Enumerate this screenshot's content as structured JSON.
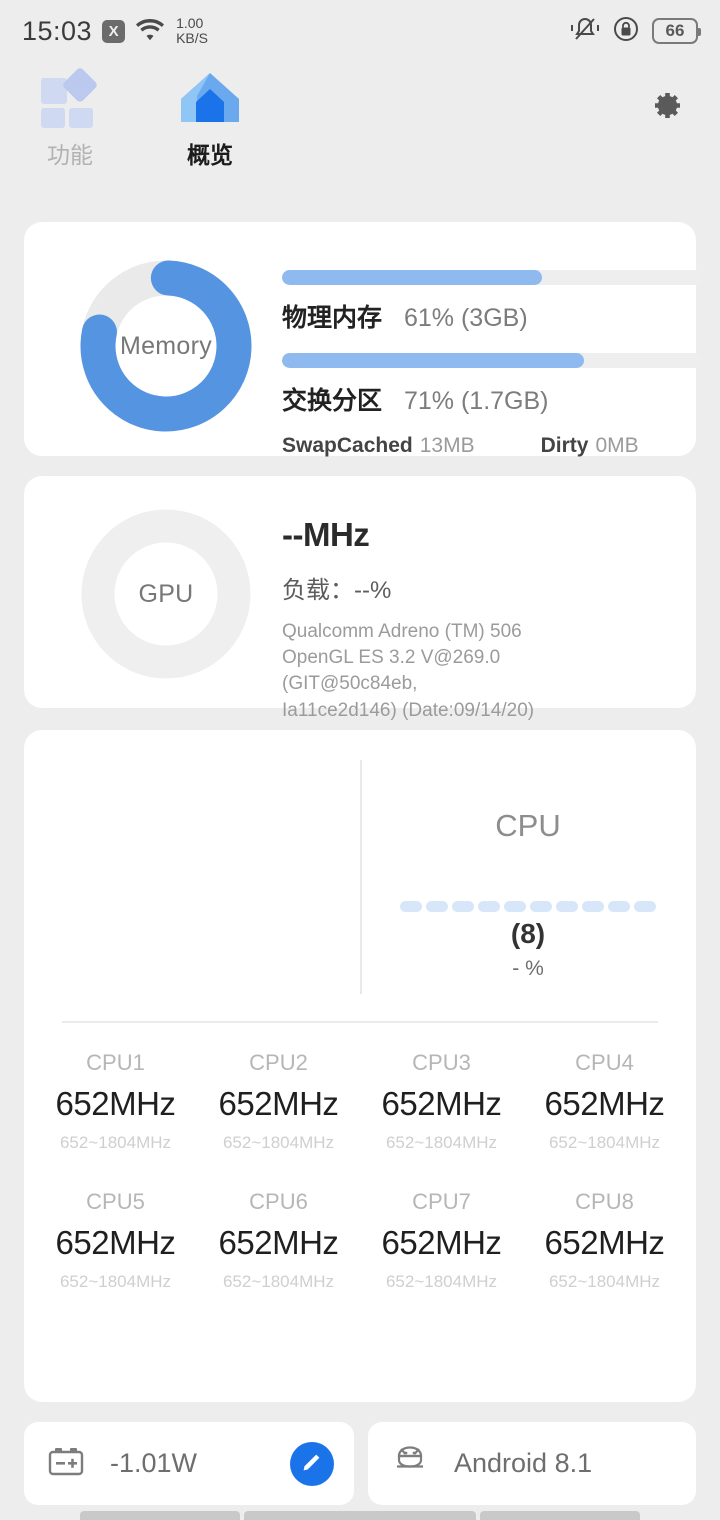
{
  "status_bar": {
    "time": "15:03",
    "x_badge": "X",
    "net_speed_value": "1.00",
    "net_speed_unit": "KB/S",
    "battery_level": "66",
    "icons": [
      "x-badge-icon",
      "wifi-icon",
      "vibrate-off-icon",
      "lock-icon",
      "battery-icon"
    ]
  },
  "tabs": [
    {
      "label": "功能",
      "icon": "grid-shapes-icon",
      "active": false
    },
    {
      "label": "概览",
      "icon": "home-icon",
      "active": true
    }
  ],
  "header": {
    "settings_icon": "gear-icon"
  },
  "memory_card": {
    "ring_label": "Memory",
    "ring_percent": 61,
    "rows": [
      {
        "name": "物理内存",
        "value": "61% (3GB)",
        "percent": 61
      },
      {
        "name": "交换分区",
        "value": "71% (1.7GB)",
        "percent": 71
      }
    ],
    "extras": [
      {
        "key": "SwapCached",
        "value": "13MB"
      },
      {
        "key": "Dirty",
        "value": "0MB"
      }
    ]
  },
  "gpu_card": {
    "ring_label": "GPU",
    "ring_percent": 0,
    "frequency": "--MHz",
    "load": "负载：--%",
    "info_lines": [
      "Qualcomm Adreno (TM) 506",
      "OpenGL ES 3.2 V@269.0 (GIT@50c84eb,",
      "Ia11ce2d146) (Date:09/14/20)"
    ]
  },
  "cpu_card": {
    "title": "CPU",
    "core_count": "(8)",
    "usage": "- %",
    "bar_count": 10,
    "cores": [
      {
        "name": "CPU1",
        "freq": "652MHz",
        "range": "652~1804MHz"
      },
      {
        "name": "CPU2",
        "freq": "652MHz",
        "range": "652~1804MHz"
      },
      {
        "name": "CPU3",
        "freq": "652MHz",
        "range": "652~1804MHz"
      },
      {
        "name": "CPU4",
        "freq": "652MHz",
        "range": "652~1804MHz"
      },
      {
        "name": "CPU5",
        "freq": "652MHz",
        "range": "652~1804MHz"
      },
      {
        "name": "CPU6",
        "freq": "652MHz",
        "range": "652~1804MHz"
      },
      {
        "name": "CPU7",
        "freq": "652MHz",
        "range": "652~1804MHz"
      },
      {
        "name": "CPU8",
        "freq": "652MHz",
        "range": "652~1804MHz"
      }
    ]
  },
  "battery_card": {
    "icon": "battery-terminal-icon",
    "power": "-1.01W",
    "action_icon": "pencil-icon"
  },
  "os_card": {
    "icon": "android-icon",
    "label": "Android 8.1"
  },
  "colors": {
    "accent_blue": "#5594e0",
    "bar_blue": "#8fbaef",
    "fab_blue": "#1a73e8",
    "track_gray": "#eeeeee",
    "page_bg": "#ededed"
  }
}
